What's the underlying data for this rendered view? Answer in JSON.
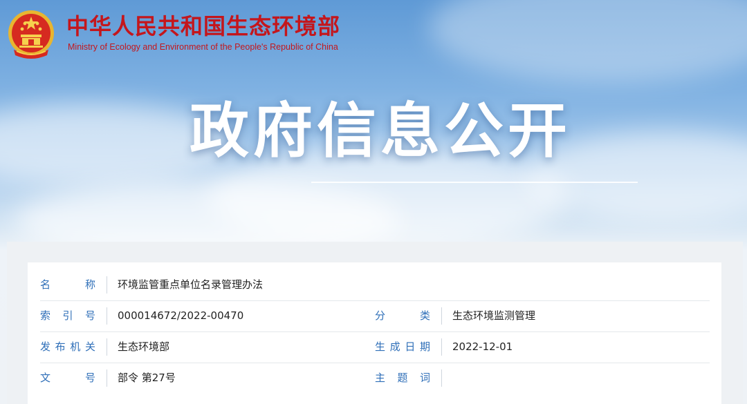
{
  "header": {
    "ministry_cn": "中华人民共和国生态环境部",
    "ministry_en": "Ministry of Ecology and Environment of the People's Republic of China"
  },
  "banner": {
    "title": "政府信息公开"
  },
  "info": {
    "name_label": "名称",
    "name_value": "环境监管重点单位名录管理办法",
    "index_label": "索引号",
    "index_value": "000014672/2022-00470",
    "category_label": "分类",
    "category_value": "生态环境监测管理",
    "issuer_label": "发布机关",
    "issuer_value": "生态环境部",
    "date_label": "生成日期",
    "date_value": "2022-12-01",
    "docno_label": "文号",
    "docno_value": "部令 第27号",
    "keywords_label": "主题词",
    "keywords_value": ""
  },
  "colors": {
    "brand_red": "#c4161c",
    "label_blue": "#2f6fb8",
    "emblem_gold": "#e8b530"
  },
  "icons": {
    "emblem": "national-emblem-icon"
  }
}
